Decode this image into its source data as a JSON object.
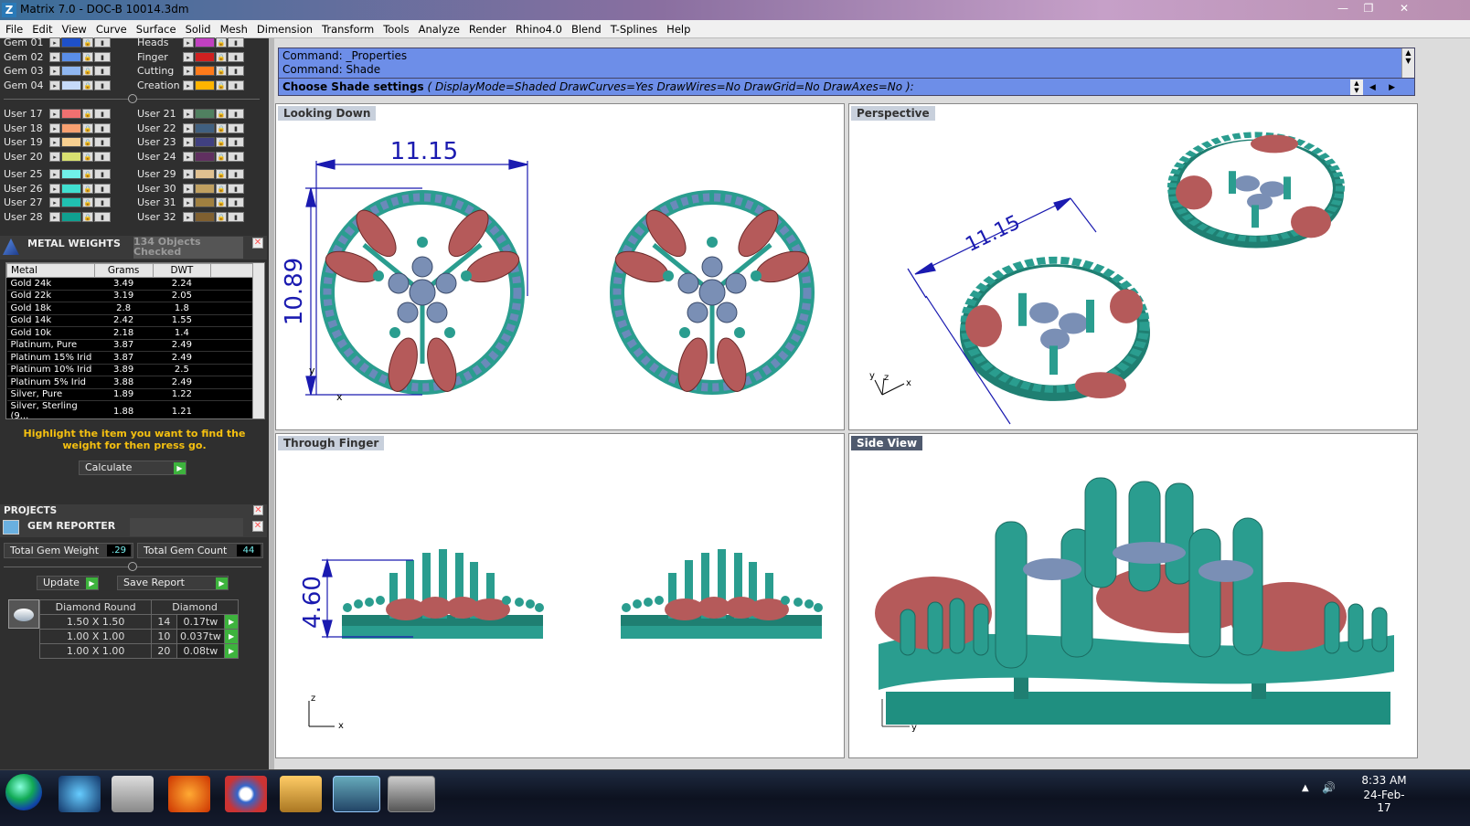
{
  "window": {
    "title": "Matrix 7.0 - DOC-B 10014.3dm",
    "app_icon": "Z"
  },
  "menu": [
    "File",
    "Edit",
    "View",
    "Curve",
    "Surface",
    "Solid",
    "Mesh",
    "Dimension",
    "Transform",
    "Tools",
    "Analyze",
    "Render",
    "Rhino4.0",
    "Blend",
    "T-Splines",
    "Help"
  ],
  "layers_top": {
    "left": [
      {
        "name": "Gem 01",
        "color": "#1e50c8"
      },
      {
        "name": "Gem 02",
        "color": "#5a8ee8"
      },
      {
        "name": "Gem 03",
        "color": "#8fb6f0"
      },
      {
        "name": "Gem 04",
        "color": "#c6daf8"
      }
    ],
    "right": [
      {
        "name": "Heads",
        "color": "#c040c0"
      },
      {
        "name": "Finger",
        "color": "#d02020"
      },
      {
        "name": "Cutting",
        "color": "#ff7a1a"
      },
      {
        "name": "Creation",
        "color": "#ffb400"
      }
    ]
  },
  "layers_mid": {
    "left": [
      {
        "name": "User 17",
        "color": "#f07070"
      },
      {
        "name": "User 18",
        "color": "#f8a070"
      },
      {
        "name": "User 19",
        "color": "#f8d090"
      },
      {
        "name": "User 20",
        "color": "#d8e070"
      },
      {
        "name": "User 25",
        "color": "#70f0e8"
      },
      {
        "name": "User 26",
        "color": "#40e0d0"
      },
      {
        "name": "User 27",
        "color": "#20c0b0"
      },
      {
        "name": "User 28",
        "color": "#10a090"
      }
    ],
    "right": [
      {
        "name": "User 21",
        "color": "#508060"
      },
      {
        "name": "User 22",
        "color": "#406080"
      },
      {
        "name": "User 23",
        "color": "#404080"
      },
      {
        "name": "User 24",
        "color": "#603060"
      },
      {
        "name": "User 29",
        "color": "#e0c090"
      },
      {
        "name": "User 30",
        "color": "#c0a060"
      },
      {
        "name": "User 31",
        "color": "#a08040"
      },
      {
        "name": "User 32",
        "color": "#806030"
      }
    ]
  },
  "metal_weights": {
    "title": "METAL WEIGHTS",
    "status": "134 Objects Checked",
    "columns": [
      "Metal",
      "Grams",
      "DWT"
    ],
    "rows": [
      [
        "Gold 24k",
        "3.49",
        "2.24"
      ],
      [
        "Gold 22k",
        "3.19",
        "2.05"
      ],
      [
        "Gold 18k",
        "2.8",
        "1.8"
      ],
      [
        "Gold 14k",
        "2.42",
        "1.55"
      ],
      [
        "Gold 10k",
        "2.18",
        "1.4"
      ],
      [
        "Platinum, Pure",
        "3.87",
        "2.49"
      ],
      [
        "Platinum 15% Irid",
        "3.87",
        "2.49"
      ],
      [
        "Platinum 10% Irid",
        "3.89",
        "2.5"
      ],
      [
        "Platinum 5% Irid",
        "3.88",
        "2.49"
      ],
      [
        "Silver, Pure",
        "1.89",
        "1.22"
      ],
      [
        "Silver, Sterling (9...",
        "1.88",
        "1.21"
      ]
    ],
    "hint": "Highlight the item you want to find the weight for then press go.",
    "calculate_label": "Calculate"
  },
  "projects": {
    "title": "PROJECTS"
  },
  "gem_reporter": {
    "title": "GEM REPORTER",
    "total_weight_label": "Total Gem Weight",
    "total_weight_value": ".29",
    "total_count_label": "Total Gem Count",
    "total_count_value": "44",
    "update_label": "Update",
    "save_label": "Save Report",
    "columns": [
      "Diamond Round",
      "",
      "Diamond"
    ],
    "rows": [
      [
        "1.50 X 1.50",
        "14",
        "0.17tw"
      ],
      [
        "1.00 X 1.00",
        "10",
        "0.037tw"
      ],
      [
        "1.00 X 1.00",
        "20",
        "0.08tw"
      ]
    ]
  },
  "command": {
    "line1": "Command: _Properties",
    "line2": "Command: Shade",
    "prompt_bold": "Choose Shade settings",
    "prompt_rest": " ( DisplayMode=Shaded  DrawCurves=Yes  DrawWires=No  DrawGrid=No  DrawAxes=No ):"
  },
  "viewports": {
    "top_left": "Looking Down",
    "top_right": "Perspective",
    "bottom_left": "Through Finger",
    "bottom_right": "Side View"
  },
  "dimensions": {
    "width": "11.15",
    "height": "10.89",
    "side_height": "4.60",
    "persp_width": "11.15"
  },
  "axes": {
    "x": "x",
    "y": "y",
    "z": "z"
  },
  "colors": {
    "metal": "#2a9d8f",
    "petal": "#b55a5a",
    "gem": "#7a8fb5",
    "dim": "#1a1ab0",
    "cmd_bg": "#6d8ee8"
  },
  "taskbar": {
    "time": "8:33 AM",
    "date": "24-Feb-17"
  }
}
